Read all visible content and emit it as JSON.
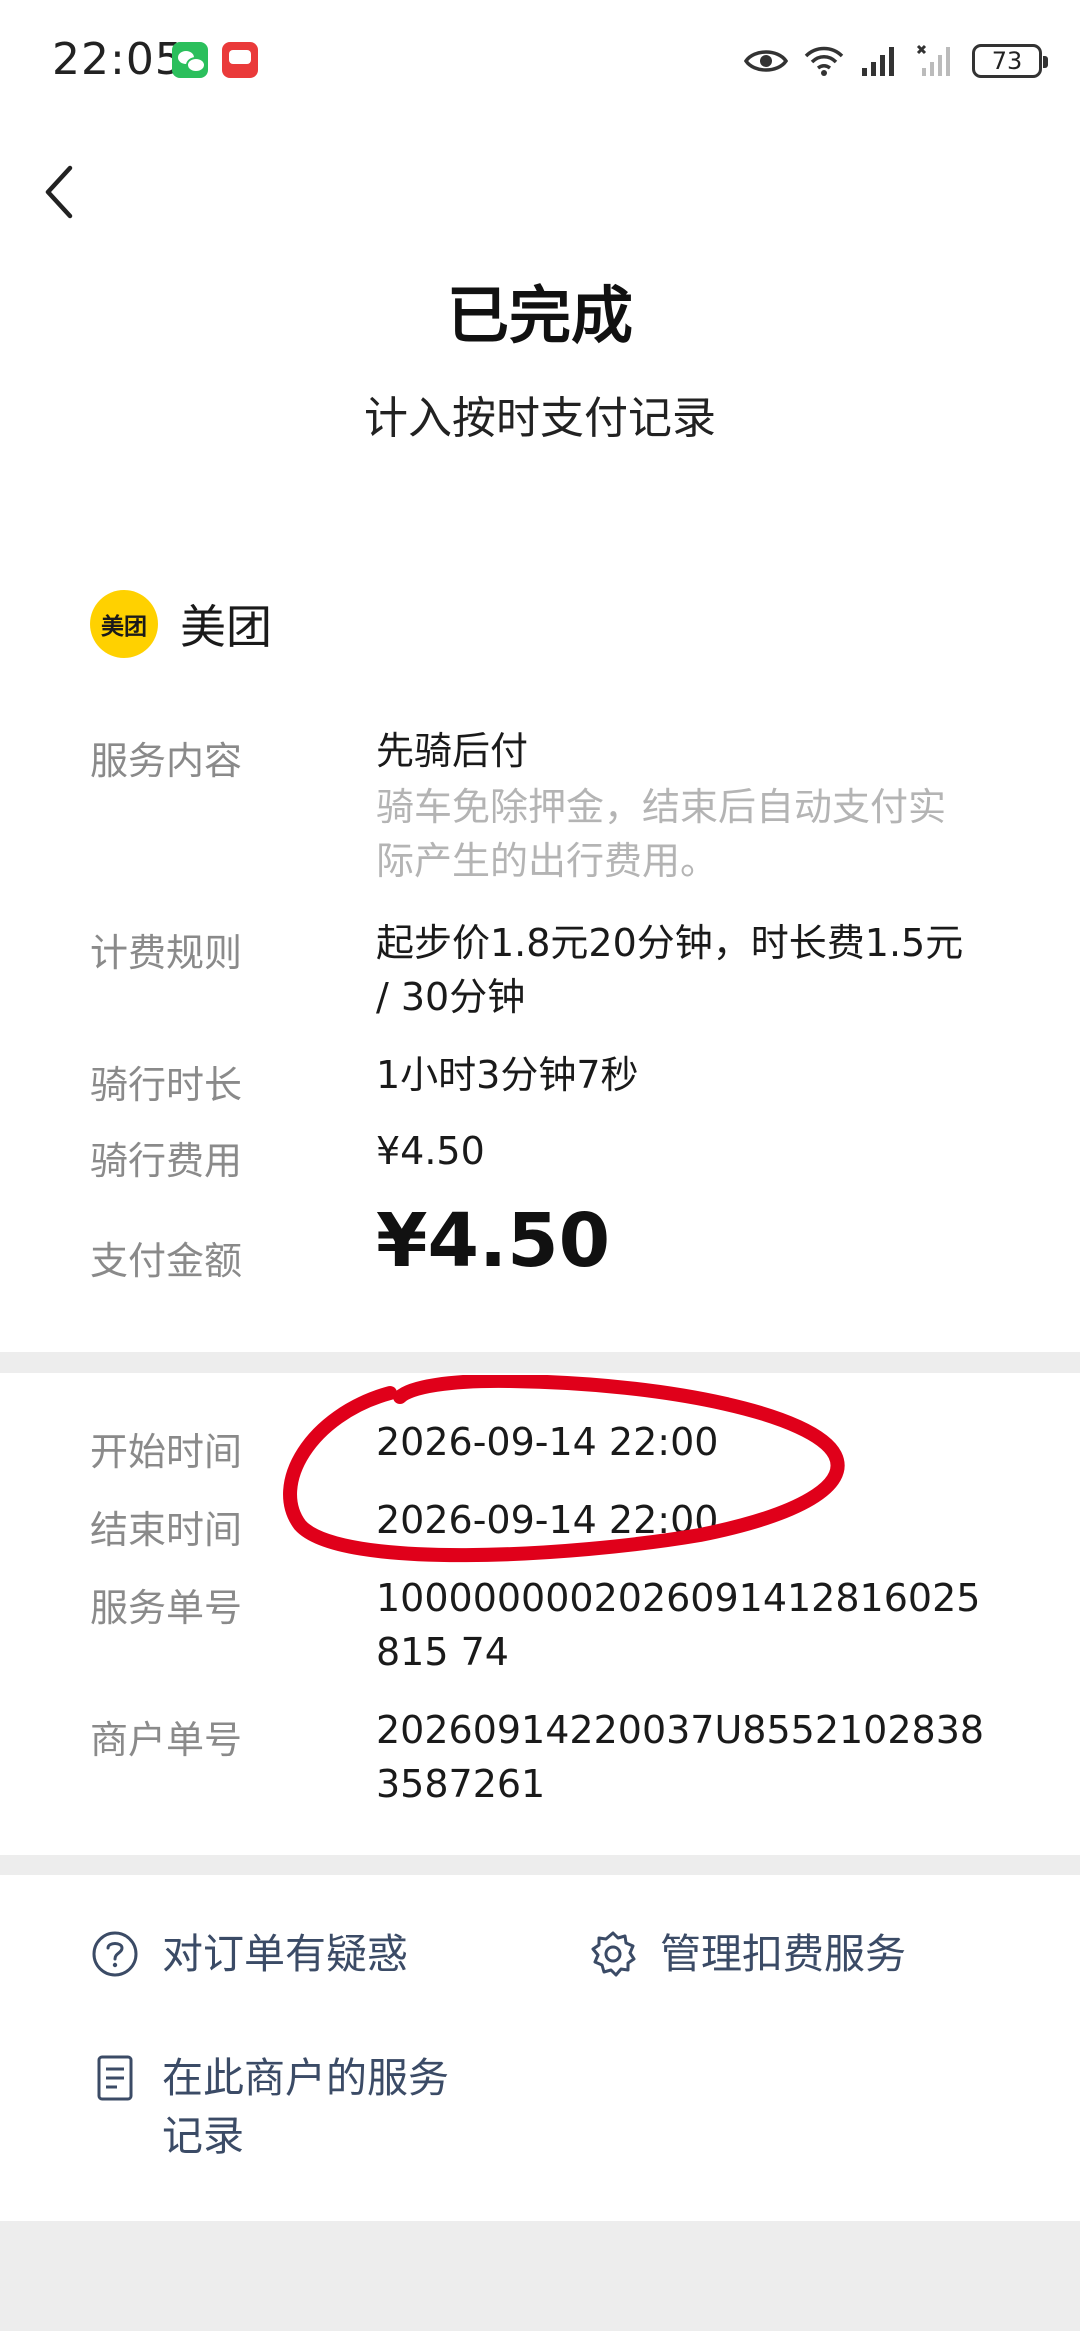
{
  "status_bar": {
    "time": "22:05",
    "battery": "73",
    "icons": [
      "wechat-icon",
      "red-app-icon",
      "eye-icon",
      "wifi-icon",
      "signal-icon",
      "signal-no-service-icon",
      "battery-icon"
    ]
  },
  "header": {
    "back_icon": "chevron-left-icon",
    "status": "已完成",
    "subtitle": "计入按时支付记录"
  },
  "merchant": {
    "logo_text": "美团",
    "name": "美团",
    "logo_color": "#ffd100"
  },
  "details": {
    "service_label": "服务内容",
    "service_value": "先骑后付",
    "service_desc": "骑车免除押金，结束后自动支付实际产生的出行费用。",
    "rule_label": "计费规则",
    "rule_value": "起步价1.8元20分钟，时长费1.5元 / 30分钟",
    "duration_label": "骑行时长",
    "duration_value": "1小时3分钟7秒",
    "fee_label": "骑行费用",
    "fee_value": "¥4.50",
    "pay_label": "支付金额",
    "pay_value": "¥4.50"
  },
  "order": {
    "start_label": "开始时间",
    "start_value": "2026-09-14 22:00",
    "end_label": "结束时间",
    "end_value": "2026-09-14 22:00",
    "service_no_label": "服务单号",
    "service_no_value": "1000000002026091412816025815 74",
    "merchant_no_label": "商户单号",
    "merchant_no_value": "20260914220037U85521028383587261"
  },
  "actions": {
    "question": "对订单有疑惑",
    "manage": "管理扣费服务",
    "records": "在此商户的服务记录"
  },
  "colors": {
    "annotation": "#e0001a",
    "action_text": "#3b4b66",
    "divider": "#ededed"
  }
}
